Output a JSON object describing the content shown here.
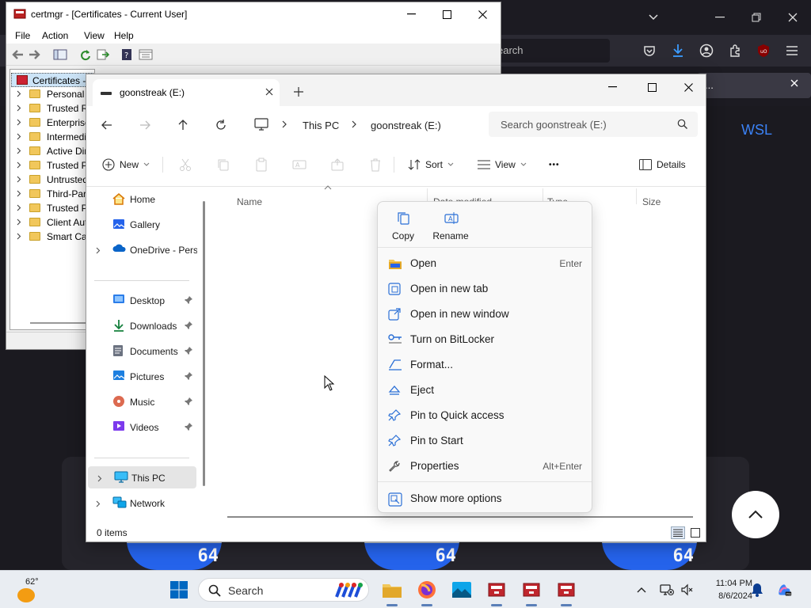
{
  "browser": {
    "search_placeholder": "earch",
    "notification_text": "...",
    "brand_label": "WSL",
    "tile_badges": [
      "64",
      "64",
      "64"
    ]
  },
  "certmgr": {
    "title": "certmgr - [Certificates - Current User]",
    "menu": [
      "File",
      "Action",
      "View",
      "Help"
    ],
    "root_label": "Certificates - Current User",
    "tree": [
      "Personal",
      "Trusted Root Certification Authorities",
      "Enterprise Trust",
      "Intermediate Certification Authorities",
      "Active Directory User Object",
      "Trusted Publishers",
      "Untrusted Certificates",
      "Third-Party Root Certification Authorities",
      "Trusted People",
      "Client Authentication Issuers",
      "Smart Card Trusted Roots"
    ]
  },
  "explorer": {
    "tab_title": "goonstreak (E:)",
    "breadcrumb": [
      "This PC",
      "goonstreak (E:)"
    ],
    "search_placeholder": "Search goonstreak (E:)",
    "commands": {
      "new": "New",
      "sort": "Sort",
      "view": "View",
      "more": "•••",
      "details": "Details"
    },
    "sidebar": [
      {
        "label": "Home",
        "icon": "home-icon"
      },
      {
        "label": "Gallery",
        "icon": "gallery-icon"
      },
      {
        "label": "OneDrive - Personal",
        "icon": "onedrive-icon"
      },
      {
        "label": "Desktop",
        "icon": "desktop-folder-icon"
      },
      {
        "label": "Downloads",
        "icon": "downloads-folder-icon"
      },
      {
        "label": "Documents",
        "icon": "documents-folder-icon"
      },
      {
        "label": "Pictures",
        "icon": "pictures-folder-icon"
      },
      {
        "label": "Music",
        "icon": "music-folder-icon"
      },
      {
        "label": "Videos",
        "icon": "videos-folder-icon"
      },
      {
        "label": "This PC",
        "icon": "this-pc-icon"
      },
      {
        "label": "Network",
        "icon": "network-icon"
      }
    ],
    "columns": [
      "Name",
      "Date modified",
      "Type",
      "Size"
    ],
    "status": "0 items"
  },
  "context_menu": {
    "quick": [
      {
        "label": "Copy",
        "icon": "copy-icon"
      },
      {
        "label": "Rename",
        "icon": "rename-icon"
      }
    ],
    "items": [
      {
        "label": "Open",
        "accel": "Enter",
        "icon": "open-folder-icon"
      },
      {
        "label": "Open in new tab",
        "accel": "",
        "icon": "new-tab-icon"
      },
      {
        "label": "Open in new window",
        "accel": "",
        "icon": "new-window-icon"
      },
      {
        "label": "Turn on BitLocker",
        "accel": "",
        "icon": "bitlocker-key-icon"
      },
      {
        "label": "Format...",
        "accel": "",
        "icon": "format-icon"
      },
      {
        "label": "Eject",
        "accel": "",
        "icon": "eject-icon"
      },
      {
        "label": "Pin to Quick access",
        "accel": "",
        "icon": "pin-icon"
      },
      {
        "label": "Pin to Start",
        "accel": "",
        "icon": "pin-icon"
      },
      {
        "label": "Properties",
        "accel": "Alt+Enter",
        "icon": "wrench-icon"
      }
    ],
    "more_options": "Show more options"
  },
  "taskbar": {
    "weather_temp": "62°",
    "search_label": "Search",
    "clock_time": "11:04 PM",
    "clock_date": "8/6/2024",
    "colors": {
      "accent": "#0067c0",
      "folder": "#f1c75b"
    }
  }
}
